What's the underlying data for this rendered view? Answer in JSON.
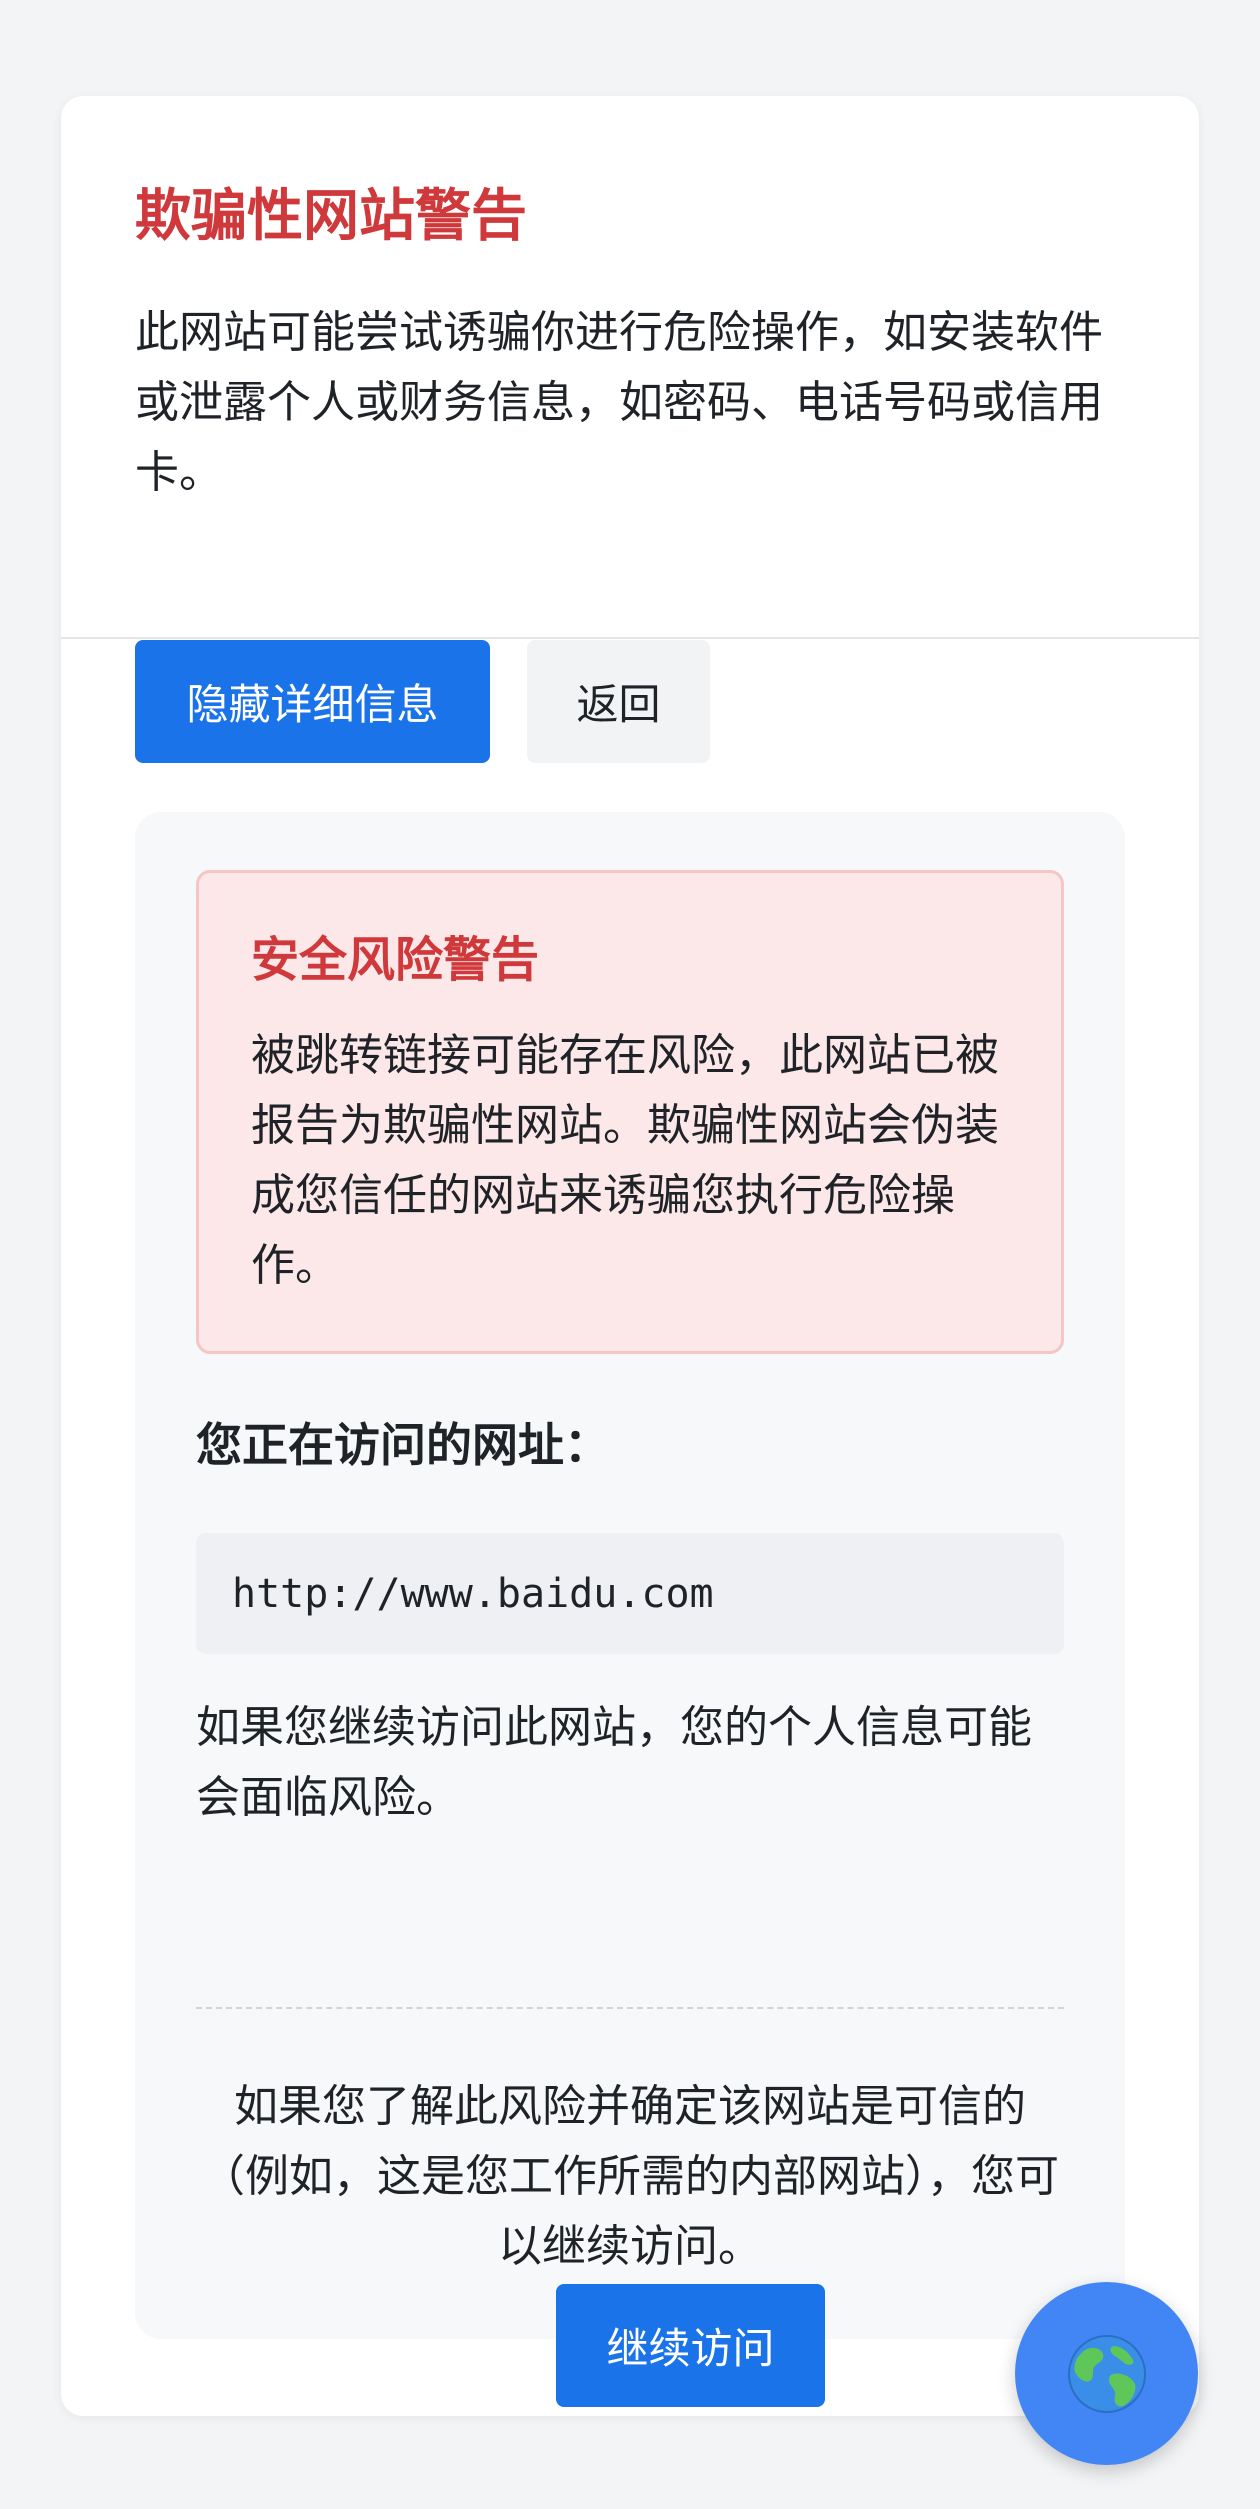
{
  "header": {
    "title": "欺骗性网站警告",
    "intro": "此网站可能尝试诱骗你进行危险操作，如安装软件或泄露个人或财务信息，如密码、电话号码或信用卡。"
  },
  "actions": {
    "hide_details_label": "隐藏详细信息",
    "back_label": "返回"
  },
  "details": {
    "risk_title": "安全风险警告",
    "risk_text": "被跳转链接可能存在风险，此网站已被报告为欺骗性网站。欺骗性网站会伪装成您信任的网站来诱骗您执行危险操作。",
    "url_label": "您正在访问的网址：",
    "url": "http://www.baidu.com",
    "warning_text": "如果您继续访问此网站，您的个人信息可能会面临风险。",
    "continue_text": "如果您了解此风险并确定该网站是可信的（例如，这是您工作所需的内部网站），您可以继续访问。",
    "continue_label": "继续访问"
  },
  "colors": {
    "accent": "#1a73e8",
    "danger": "#d0393b",
    "fab": "#4285f4"
  },
  "icons": {
    "fab": "globe-icon"
  }
}
